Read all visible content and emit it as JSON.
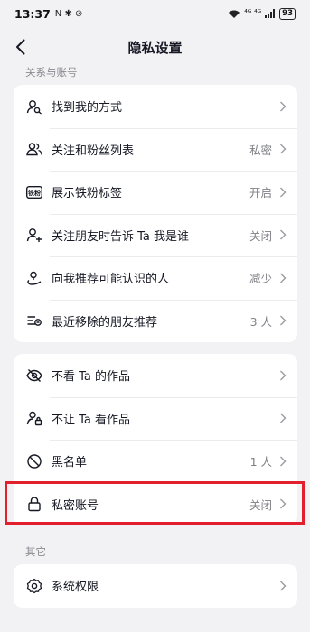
{
  "status_bar": {
    "time": "13:37",
    "left_icons": "N ✱ ⊘",
    "signal": "⁴ᴳ ⁴ᴳ",
    "battery": "93"
  },
  "nav": {
    "title": "隐私设置",
    "back_icon": "chevron-left-icon"
  },
  "sections": {
    "relations_label": "关系与账号",
    "other_label": "其它"
  },
  "group1": [
    {
      "icon": "person-search-icon",
      "label": "找到我的方式",
      "value": ""
    },
    {
      "icon": "people-icon",
      "label": "关注和粉丝列表",
      "value": "私密"
    },
    {
      "icon": "iron-fan-badge-icon",
      "label": "展示铁粉标签",
      "value": "开启",
      "badge_text": "铁粉"
    },
    {
      "icon": "person-add-icon",
      "label": "关注朋友时告诉 Ta 我是谁",
      "value": "关闭"
    },
    {
      "icon": "person-location-icon",
      "label": "向我推荐可能认识的人",
      "value": "减少"
    },
    {
      "icon": "list-remove-icon",
      "label": "最近移除的朋友推荐",
      "value": "3 人"
    }
  ],
  "group2": [
    {
      "icon": "eye-off-icon",
      "label": "不看 Ta 的作品",
      "value": ""
    },
    {
      "icon": "person-lock-icon",
      "label": "不让 Ta 看作品",
      "value": ""
    },
    {
      "icon": "block-icon",
      "label": "黑名单",
      "value": "1 人"
    },
    {
      "icon": "lock-icon",
      "label": "私密账号",
      "value": "关闭"
    }
  ],
  "group3": [
    {
      "icon": "gear-icon",
      "label": "系统权限",
      "value": ""
    }
  ],
  "colors": {
    "highlight": "#e2202d",
    "background": "#f2f2f4"
  }
}
